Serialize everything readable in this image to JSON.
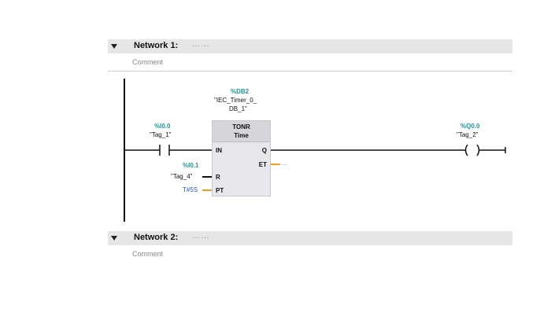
{
  "network1": {
    "title": "Network 1:",
    "dots": "……",
    "comment": "Comment"
  },
  "network2": {
    "title": "Network 2:",
    "dots": "……",
    "comment": "Comment"
  },
  "contact_no": {
    "address": "%I0.0",
    "tag": "\"Tag_1\""
  },
  "timer": {
    "instance_address": "%DB2",
    "instance_line1": "\"IEC_Timer_0_",
    "instance_line2": "DB_1\"",
    "type": "TONR",
    "subtype": "Time",
    "pin_in": "IN",
    "pin_r": "R",
    "pin_pt": "PT",
    "pin_q": "Q",
    "pin_et": "ET",
    "et_value": "...",
    "pt_value": "T#5S"
  },
  "reset_input": {
    "address": "%I0.1",
    "tag": "\"Tag_4\""
  },
  "coil": {
    "address": "%Q0.0",
    "tag": "\"Tag_2\""
  },
  "colors": {
    "address": "#1a9a9a",
    "connector_orange": "#f0a020",
    "literal_blue": "#2a55c4"
  }
}
